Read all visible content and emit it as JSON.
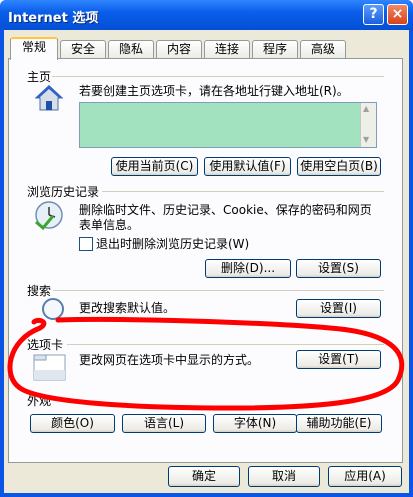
{
  "window": {
    "title": "Internet 选项",
    "help": "?",
    "close": "×"
  },
  "tabs": [
    "常规",
    "安全",
    "隐私",
    "内容",
    "连接",
    "程序",
    "高级"
  ],
  "homepage": {
    "label": "主页",
    "desc": "若要创建主页选项卡，请在各地址行键入地址(R)。",
    "value": "",
    "buttons": [
      "使用当前页(C)",
      "使用默认值(F)",
      "使用空白页(B)"
    ]
  },
  "history": {
    "label": "浏览历史记录",
    "desc_line1": "删除临时文件、历史记录、Cookie、保存的密码和网页",
    "desc_line2": "表单信息。",
    "checkbox_label": "退出时删除浏览历史记录(W)",
    "delete_btn": "删除(D)...",
    "settings_btn": "设置(S)"
  },
  "search": {
    "label": "搜索",
    "desc": "更改搜索默认值。",
    "settings_btn": "设置(I)"
  },
  "tabsection": {
    "label": "选项卡",
    "desc": "更改网页在选项卡中显示的方式。",
    "settings_btn": "设置(T)"
  },
  "appearance": {
    "label": "外观",
    "buttons": [
      "颜色(O)",
      "语言(L)",
      "字体(N)",
      "辅助功能(E)"
    ]
  },
  "footer": {
    "ok": "确定",
    "cancel": "取消",
    "apply": "应用(A)"
  },
  "colors": {
    "annotation": "#ff0000",
    "title_bar": "#0a5eea",
    "textbox": "#a3e2bf"
  }
}
